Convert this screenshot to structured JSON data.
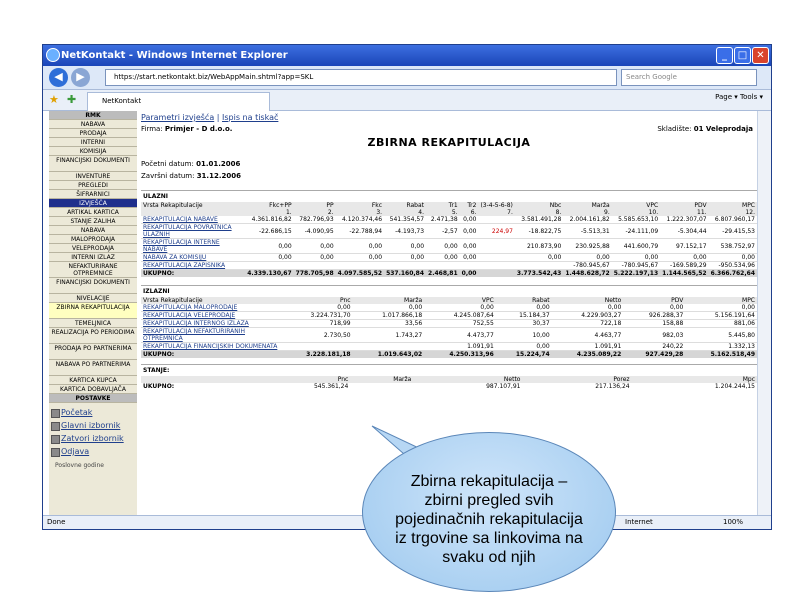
{
  "window": {
    "title": "NetKontakt - Windows Internet Explorer",
    "url": "https://start.netkontakt.biz/WebAppMain.shtml?app=SKL",
    "search_placeholder": "Search Google",
    "tab": "NetKontakt",
    "status": "Done",
    "zone": "Internet",
    "zoom": "100%",
    "tools": "Page ▾   Tools ▾"
  },
  "sidebar": {
    "header": "RMK",
    "items": [
      "NABAVA",
      "PRODAJA",
      "INTERNI",
      "KOMISIJA",
      "FINANCIJSKI DOKUMENTI",
      "INVENTURE",
      "PREGLEDI",
      "ŠIFRARNICI",
      "IZVJEŠĆA",
      "ARTIKAL KARTICA",
      "STANJE ZALIHA",
      "NABAVA",
      "MALOPRODAJA",
      "VELEPRODAJA",
      "INTERNI IZLAZ",
      "NEFAKTURIRANE OTPREMNICE",
      "FINANCIJSKI DOKUMENTI",
      "NIVELACIJE",
      "ZBIRNA REKAPITULACIJA",
      "TEMELJNICA",
      "REALIZACIJA PO PERIODIMA",
      "PRODAJA PO PARTNERIMA",
      "NABAVA PO PARTNERIMA",
      "KARTICA KUPCA",
      "KARTICA DOBAVLJAČA",
      "POSTAVKE"
    ],
    "links": [
      "Početak",
      "Glavni izbornik",
      "Zatvori izbornik",
      "Odjava"
    ],
    "footer": "Poslovne godine"
  },
  "main": {
    "links": [
      "Parametri izvješća",
      "Ispis na tiskač"
    ],
    "firma_label": "Firma:",
    "firma": "Primjer - D d.o.o.",
    "skladiste_label": "Skladište:",
    "skladiste": "01 Veleprodaja",
    "title": "ZBIRNA REKAPITULACIJA",
    "pocetni_label": "Početni datum:",
    "pocetni": "01.01.2006",
    "zavrsni_label": "Završni datum:",
    "zavrsni": "31.12.2006"
  },
  "ulazni": {
    "section": "ULAZNI",
    "headers": [
      "Vrsta Rekapitulacije",
      "Fkc+PP",
      "PP",
      "Fkc",
      "Rabat",
      "Tr1",
      "Tr2",
      "(3-4-5-6-8)",
      "Nbc",
      "Marža",
      "VPC",
      "PDV",
      "MPC"
    ],
    "nums": [
      "",
      "1.",
      "2.",
      "3.",
      "4.",
      "5.",
      "6.",
      "7.",
      "8.",
      "9.",
      "10.",
      "11.",
      "12."
    ],
    "rows": [
      [
        "REKAPITULACIJA NABAVE",
        "4.361.816,82",
        "782.796,93",
        "4.120.374,46",
        "541.354,57",
        "2.471,38",
        "0,00",
        "",
        "3.581.491,28",
        "2.004.161,82",
        "5.585.653,10",
        "1.222.307,07",
        "6.807.960,17"
      ],
      [
        "REKAPITULACIJA POVRATNICA ULAZNIH",
        "-22.686,15",
        "-4.090,95",
        "-22.788,94",
        "-4.193,73",
        "-2,57",
        "0,00",
        "224,97",
        "-18.822,75",
        "-5.513,31",
        "-24.111,09",
        "-5.304,44",
        "-29.415,53"
      ],
      [
        "REKAPITULACIJA INTERNE NABAVE",
        "0,00",
        "0,00",
        "0,00",
        "0,00",
        "0,00",
        "0,00",
        "",
        "210.873,90",
        "230.925,88",
        "441.600,79",
        "97.152,17",
        "538.752,97"
      ],
      [
        "NABAVA ZA KOMISIJU",
        "0,00",
        "0,00",
        "0,00",
        "0,00",
        "0,00",
        "0,00",
        "",
        "0,00",
        "0,00",
        "0,00",
        "0,00",
        "0,00"
      ],
      [
        "REKAPITULACIJA ZAPISNIKA",
        "",
        "",
        "",
        "",
        "",
        "",
        "",
        "",
        "-780.945,67",
        "-780.945,67",
        "-169.589,29",
        "-950.534,96"
      ]
    ],
    "total": [
      "UKUPNO:",
      "4.339.130,67",
      "778.705,98",
      "4.097.585,52",
      "537.160,84",
      "2.468,81",
      "0,00",
      "",
      "3.773.542,43",
      "1.448.628,72",
      "5.222.197,13",
      "1.144.565,52",
      "6.366.762,64"
    ]
  },
  "izlazni": {
    "section": "IZLAZNI",
    "headers": [
      "Vrsta Rekapitulacije",
      "Pnc",
      "Marža",
      "VPC",
      "Rabat",
      "Netto",
      "PDV",
      "MPC"
    ],
    "rows": [
      [
        "REKAPITULACIJA MALOPRODAJE",
        "0,00",
        "0,00",
        "0,00",
        "0,00",
        "0,00",
        "0,00",
        "0,00"
      ],
      [
        "REKAPITULACIJA VELEPRODAJE",
        "3.224.731,70",
        "1.017.866,18",
        "4.245.087,64",
        "15.184,37",
        "4.229.903,27",
        "926.288,37",
        "5.156.191,64"
      ],
      [
        "REKAPITULACIJA INTERNOG IZLAZA",
        "718,99",
        "33,56",
        "752,55",
        "30,37",
        "722,18",
        "158,88",
        "881,06"
      ],
      [
        "REKAPITULACIJA NEFAKTURIRANIH OTPREMNICA",
        "2.730,50",
        "1.743,27",
        "4.473,77",
        "10,00",
        "4.463,77",
        "982,03",
        "5.445,80"
      ],
      [
        "REKAPITULACIJA FINANCIJSKIH DOKUMENATA",
        "",
        "",
        "1.091,91",
        "0,00",
        "1.091,91",
        "240,22",
        "1.332,13"
      ]
    ],
    "total": [
      "UKUPNO:",
      "3.228.181,18",
      "1.019.643,02",
      "4.250.313,96",
      "15.224,74",
      "4.235.089,22",
      "927.429,28",
      "5.162.518,49"
    ]
  },
  "stanje": {
    "section": "STANJE:",
    "headers": [
      "",
      "Pnc",
      "Marža",
      "Netto",
      "Porez",
      "Mpc"
    ],
    "row": [
      "UKUPNO:",
      "545.361,24",
      "",
      "987.107,91",
      "217.136,24",
      "1.204.244,15"
    ]
  },
  "callout": {
    "line1": "Zbirna rekapitulacija –",
    "line2": "zbirni pregled svih",
    "line3": "pojedinačnih rekapitulacija",
    "line4": "iz trgovine sa linkovima na",
    "line5": "svaku od njih"
  }
}
